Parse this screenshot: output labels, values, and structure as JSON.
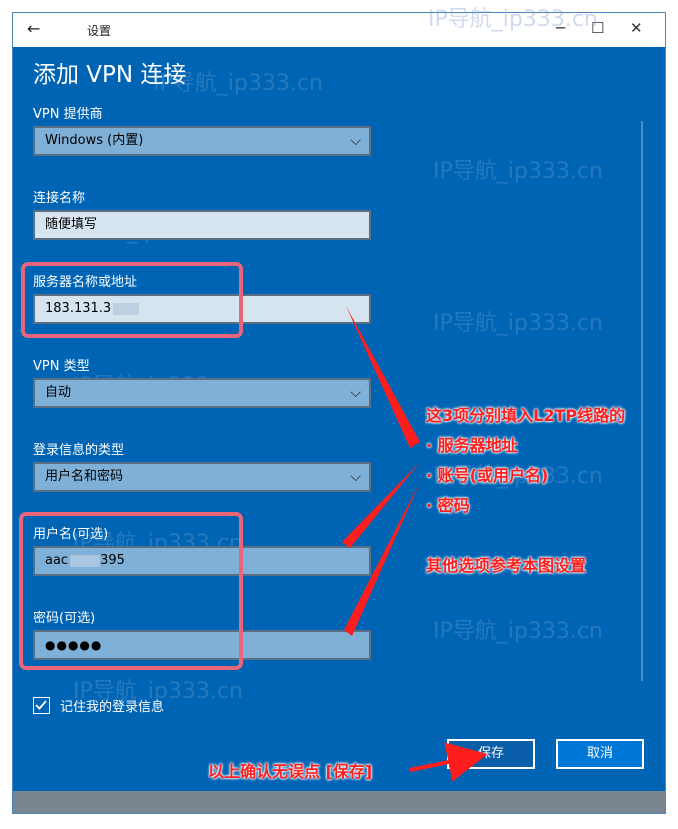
{
  "window": {
    "title": "设置"
  },
  "page": {
    "heading": "添加 VPN 连接"
  },
  "form": {
    "provider": {
      "label": "VPN 提供商",
      "value": "Windows (内置)"
    },
    "connection_name": {
      "label": "连接名称",
      "value": "随便填写"
    },
    "server": {
      "label": "服务器名称或地址",
      "value": "183.131.3"
    },
    "vpn_type": {
      "label": "VPN 类型",
      "value": "自动"
    },
    "signin_type": {
      "label": "登录信息的类型",
      "value": "用户名和密码"
    },
    "username": {
      "label": "用户名(可选)",
      "value_start": "aac",
      "value_end": "395"
    },
    "password": {
      "label": "密码(可选)",
      "value": "●●●●●"
    },
    "remember": {
      "label": "记住我的登录信息",
      "checked": true
    }
  },
  "buttons": {
    "save": "保存",
    "cancel": "取消"
  },
  "annotations": {
    "line1": "这3项分别填入L2TP线路的",
    "line2": "· 服务器地址",
    "line3": "· 账号(或用户名)",
    "line4": "· 密码",
    "line5": "其他选项参考本图设置",
    "bottom": "以上确认无误点 [保存]"
  },
  "watermark": "IP导航_ip333.cn",
  "colors": {
    "background": "#0064b4",
    "annotation": "#ff1e1e",
    "highlight": "#e8657a"
  }
}
